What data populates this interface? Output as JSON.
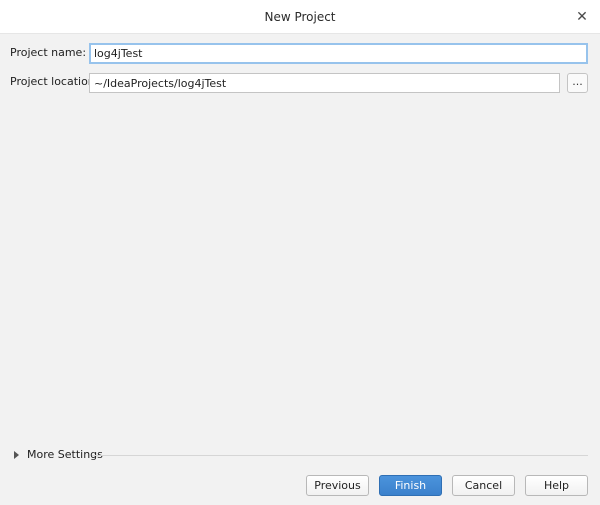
{
  "window": {
    "title": "New Project"
  },
  "form": {
    "project_name_label": "Project name:",
    "project_name_value": "log4jTest",
    "project_location_label": "Project location:",
    "project_location_value": "~/IdeaProjects/log4jTest",
    "browse_label": "..."
  },
  "more_settings": {
    "label": "More Settings"
  },
  "buttons": {
    "previous": "Previous",
    "finish": "Finish",
    "cancel": "Cancel",
    "help": "Help"
  },
  "colors": {
    "primary_button": "#3b81cc",
    "focus_ring": "#97c3ec",
    "background": "#f2f2f2"
  }
}
